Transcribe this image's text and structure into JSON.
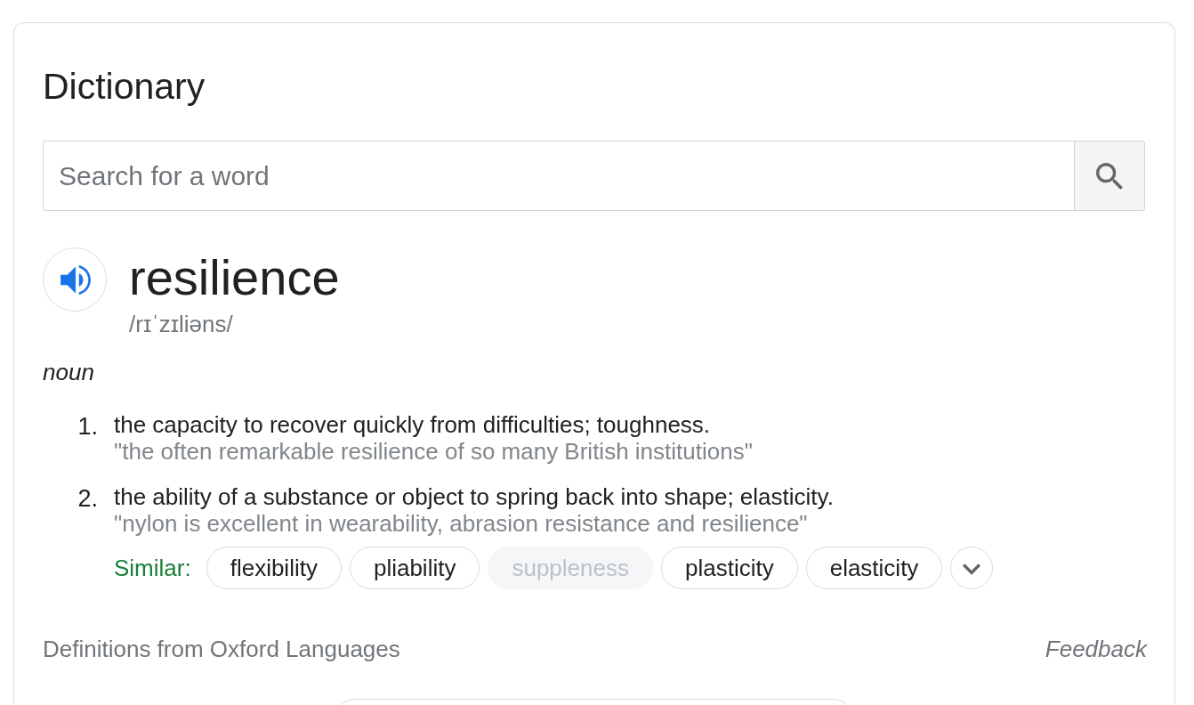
{
  "title": "Dictionary",
  "search": {
    "placeholder": "Search for a word"
  },
  "entry": {
    "word": "resilience",
    "phonetic": "/rɪˈzɪliəns/",
    "part_of_speech": "noun",
    "senses": [
      {
        "number": "1.",
        "definition": "the capacity to recover quickly from difficulties; toughness.",
        "example": "\"the often remarkable resilience of so many British institutions\""
      },
      {
        "number": "2.",
        "definition": "the ability of a substance or object to spring back into shape; elasticity.",
        "example": "\"nylon is excellent in wearability, abrasion resistance and resilience\"",
        "similar": {
          "label": "Similar:",
          "words": [
            {
              "text": "flexibility",
              "disabled": false
            },
            {
              "text": "pliability",
              "disabled": false
            },
            {
              "text": "suppleness",
              "disabled": true
            },
            {
              "text": "plasticity",
              "disabled": false
            },
            {
              "text": "elasticity",
              "disabled": false
            }
          ]
        }
      }
    ]
  },
  "footer": {
    "source": "Definitions from Oxford Languages",
    "feedback": "Feedback"
  }
}
